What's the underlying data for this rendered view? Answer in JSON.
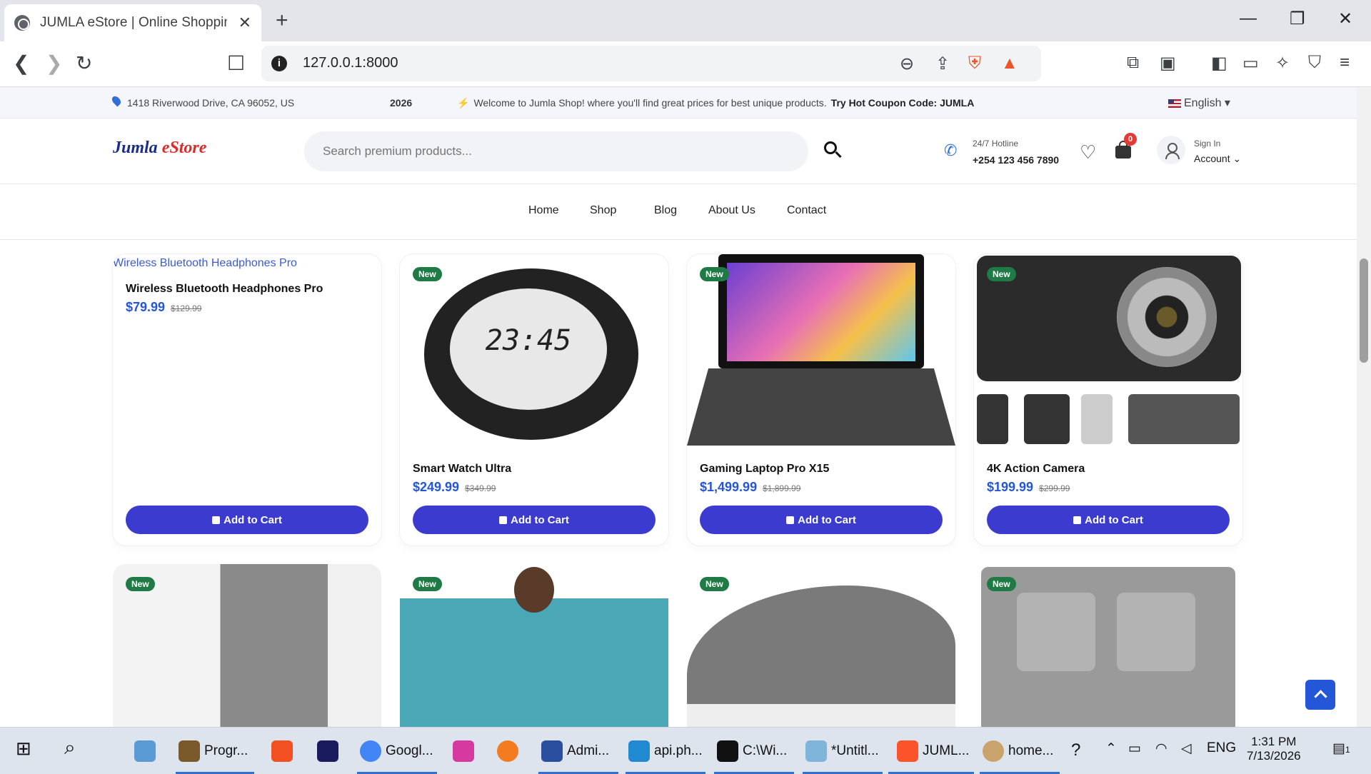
{
  "browser": {
    "tab_title": "JUMLA eStore | Online Shopping",
    "tab_close": "✕",
    "new_tab": "+",
    "url": "127.0.0.1:8000",
    "win_min": "—",
    "win_max": "❐",
    "win_close": "✕"
  },
  "topbar": {
    "address": "1418 Riverwood Drive, CA 96052, US",
    "ticker": "2026",
    "welcome": "Welcome to Jumla Shop! where you'll find great prices for best unique products.",
    "coupon": "Try Hot Coupon Code: JUMLA",
    "language": "English"
  },
  "header": {
    "logo_main": "Jumla",
    "logo_accent": "eStore",
    "search_placeholder": "Search premium products...",
    "hotline_label": "24/7 Hotline",
    "hotline_number": "+254 123 456 7890",
    "cart_count": "0",
    "signin_label": "Sign In",
    "account_label": "Account"
  },
  "nav": [
    "Home",
    "Shop",
    "Blog",
    "About Us",
    "Contact"
  ],
  "products": [
    {
      "name": "Wireless Bluetooth Headphones Pro",
      "price": "$79.99",
      "old_price": "$129.99",
      "badge": "",
      "image_alt": "Wireless Bluetooth Headphones Pro"
    },
    {
      "name": "Smart Watch Ultra",
      "price": "$249.99",
      "old_price": "$349.99",
      "badge": "New"
    },
    {
      "name": "Gaming Laptop Pro X15",
      "price": "$1,499.99",
      "old_price": "$1,899.99",
      "badge": "New"
    },
    {
      "name": "4K Action Camera",
      "price": "$199.99",
      "old_price": "$299.99",
      "badge": "New"
    }
  ],
  "row2_badges": [
    "New",
    "New",
    "New",
    "New"
  ],
  "add_to_cart": "Add to Cart",
  "watch_time": "23:45",
  "taskbar": {
    "items": [
      "Progr...",
      "Googl...",
      "Admi...",
      "api.ph...",
      "C:\\Wi...",
      "*Untitl...",
      "JUML...",
      "home..."
    ],
    "lang": "ENG",
    "time": "1:31 PM",
    "date": "7/13/2026",
    "notif_count": "1"
  },
  "colors": {
    "accent": "#3b3ccf",
    "price": "#2456d8",
    "badge": "#1f7a45",
    "cart_badge": "#e53935"
  }
}
